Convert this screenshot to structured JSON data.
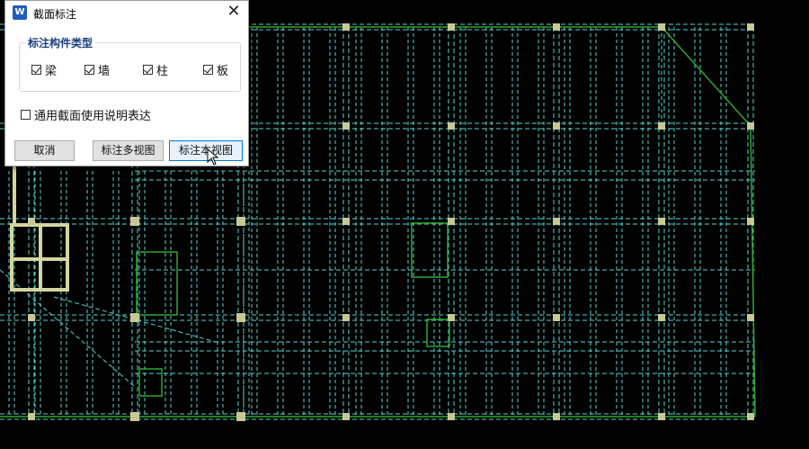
{
  "dialog": {
    "title": "截面标注",
    "app_icon": "app-logo-icon",
    "close_glyph": "✕",
    "group_label": "标注构件类型",
    "checkboxes": [
      {
        "label": "梁",
        "checked": true
      },
      {
        "label": "墙",
        "checked": true
      },
      {
        "label": "柱",
        "checked": true
      },
      {
        "label": "板",
        "checked": true
      }
    ],
    "option_label": "通用截面使用说明表达",
    "option_checked": false,
    "buttons": {
      "cancel": "取消",
      "multi_view": "标注多视图",
      "this_view": "标注本视图"
    }
  },
  "drawing": {
    "background": "#000000",
    "column_color": "#c8c896",
    "beam_color": "#5ad2d2",
    "wall_color": "#2ea82e",
    "highlight_color": "#d4d4a0"
  }
}
